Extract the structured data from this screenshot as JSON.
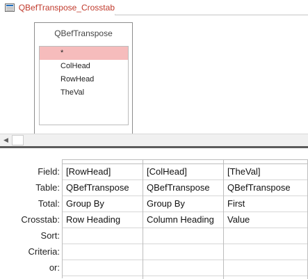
{
  "tab": {
    "title": "QBefTranspose_Crosstab",
    "icon": "query-icon"
  },
  "source_table": {
    "name": "QBefTranspose",
    "fields": [
      "*",
      "ColHead",
      "RowHead",
      "TheVal"
    ],
    "selected_index": 0
  },
  "grid": {
    "row_labels": [
      "Field:",
      "Table:",
      "Total:",
      "Crosstab:",
      "Sort:",
      "Criteria:",
      "or:"
    ],
    "columns": [
      {
        "field": "[RowHead]",
        "table": "QBefTranspose",
        "total": "Group By",
        "crosstab": "Row Heading",
        "sort": "",
        "criteria": "",
        "or": ""
      },
      {
        "field": "[ColHead]",
        "table": "QBefTranspose",
        "total": "Group By",
        "crosstab": "Column Heading",
        "sort": "",
        "criteria": "",
        "or": ""
      },
      {
        "field": "[TheVal]",
        "table": "QBefTranspose",
        "total": "First",
        "crosstab": "Value",
        "sort": "",
        "criteria": "",
        "or": ""
      }
    ]
  },
  "scrollbar": {
    "left_arrow": "◀"
  },
  "colors": {
    "tab_text": "#c0392b",
    "selected_field": "#f6bcbc",
    "splitter": "#5b5b5b"
  }
}
